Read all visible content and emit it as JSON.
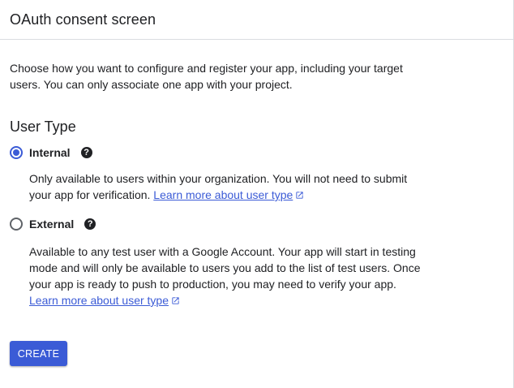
{
  "header": {
    "title": "OAuth consent screen"
  },
  "intro": {
    "text": "Choose how you want to configure and register your app, including your target users. You can only associate one app with your project."
  },
  "user_type": {
    "heading": "User Type",
    "selected": "Internal",
    "options": [
      {
        "label": "Internal",
        "checked": true,
        "description": "Only available to users within your organization. You will not need to submit your app for verification.",
        "link_text": "Learn more about user type"
      },
      {
        "label": "External",
        "checked": false,
        "description": "Available to any test user with a Google Account. Your app will start in testing mode and will only be available to users you add to the list of test users. Once your app is ready to push to production, you may need to verify your app.",
        "link_text": "Learn more about user type"
      }
    ]
  },
  "icons": {
    "help": "help-icon",
    "external_link": "open-in-new-icon"
  },
  "actions": {
    "create_label": "CREATE"
  },
  "colors": {
    "accent": "#3b5bd6",
    "text": "#202124",
    "divider": "#dadce0"
  }
}
